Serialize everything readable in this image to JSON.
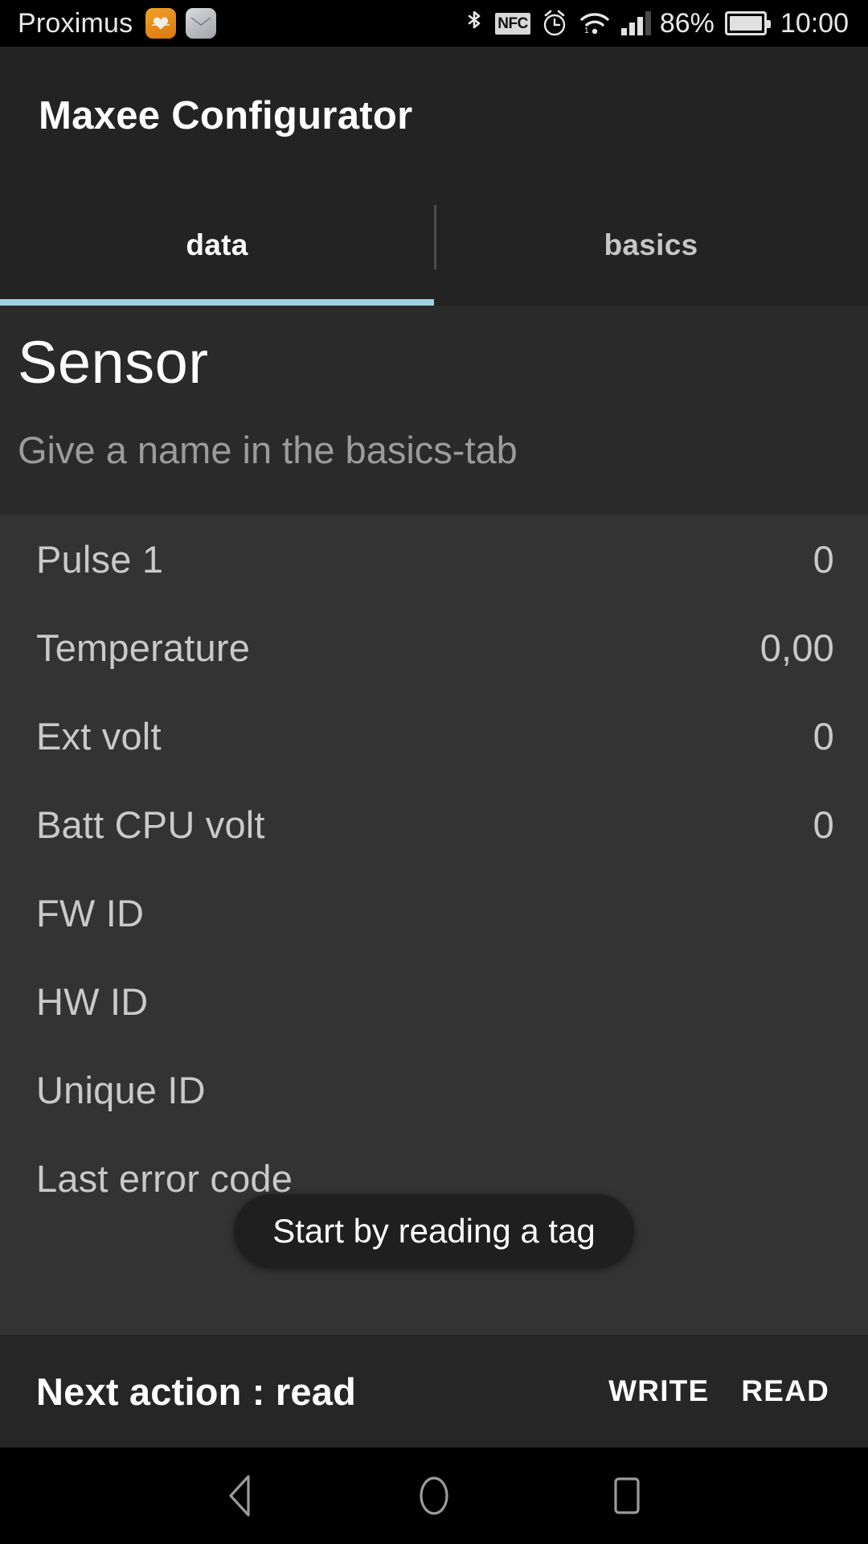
{
  "status_bar": {
    "carrier": "Proximus",
    "left_icons": [
      {
        "name": "health-app-icon",
        "color": "#e08a12"
      },
      {
        "name": "mail-app-icon",
        "color": "#b8bcc0"
      }
    ],
    "right_icons": [
      "bluetooth-icon",
      "nfc-icon",
      "alarm-icon",
      "wifi-icon",
      "cellular-signal-icon"
    ],
    "nfc_label": "NFC",
    "battery_percent": "86%",
    "clock": "10:00"
  },
  "app_bar": {
    "title": "Maxee Configurator"
  },
  "tabs": {
    "items": [
      {
        "label": "data",
        "active": true
      },
      {
        "label": "basics",
        "active": false
      }
    ],
    "indicator_color": "#9fd2e3"
  },
  "sensor": {
    "name": "Sensor",
    "subtitle": "Give a name in the basics-tab"
  },
  "data_rows": [
    {
      "label": "Pulse 1",
      "value": "0"
    },
    {
      "label": "Temperature",
      "value": "0,00"
    },
    {
      "label": "Ext volt",
      "value": "0"
    },
    {
      "label": "Batt CPU volt",
      "value": "0"
    },
    {
      "label": "FW ID",
      "value": ""
    },
    {
      "label": "HW ID",
      "value": ""
    },
    {
      "label": "Unique ID",
      "value": ""
    },
    {
      "label": "Last error code",
      "value": ""
    }
  ],
  "toast": {
    "message": "Start by reading a tag"
  },
  "action_bar": {
    "status": "Next action : read",
    "write_label": "WRITE",
    "read_label": "READ"
  },
  "nav_bar": {
    "back": "back-icon",
    "home": "home-icon",
    "recents": "recents-icon"
  }
}
